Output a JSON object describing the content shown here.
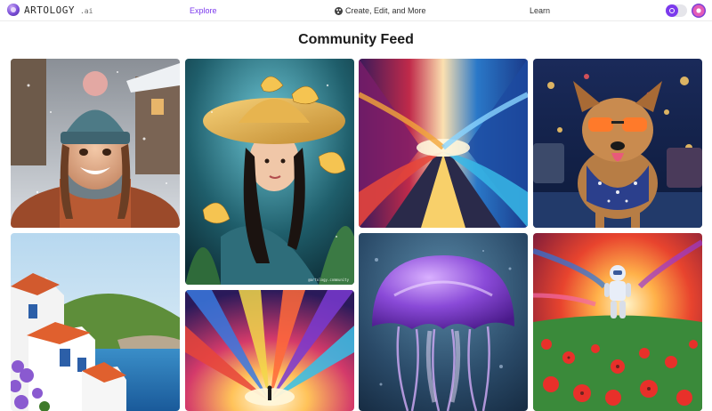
{
  "brand": {
    "name": "ARTOLOGY",
    "suffix": ".ai"
  },
  "nav": {
    "explore": "Explore",
    "create": "Create, Edit, and More",
    "learn": "Learn"
  },
  "page": {
    "title": "Community Feed"
  },
  "colors": {
    "accent": "#7c3aed",
    "nav_text": "#333333",
    "title": "#1a1a1a"
  },
  "icons": [
    "artology-logo-icon",
    "palette-icon",
    "theme-toggle",
    "user-avatar"
  ],
  "feed": {
    "cards": [
      {
        "id": "girl-beanie-snow",
        "watermark": ""
      },
      {
        "id": "woman-butterfly-hat",
        "watermark": "@artology.community"
      },
      {
        "id": "abstract-light-road",
        "watermark": ""
      },
      {
        "id": "dog-sunglasses-rain",
        "watermark": ""
      },
      {
        "id": "coastal-village",
        "watermark": ""
      },
      {
        "id": "colorful-light-burst",
        "watermark": ""
      },
      {
        "id": "purple-jellyfish",
        "watermark": ""
      },
      {
        "id": "astronaut-poppy-field",
        "watermark": ""
      }
    ]
  }
}
